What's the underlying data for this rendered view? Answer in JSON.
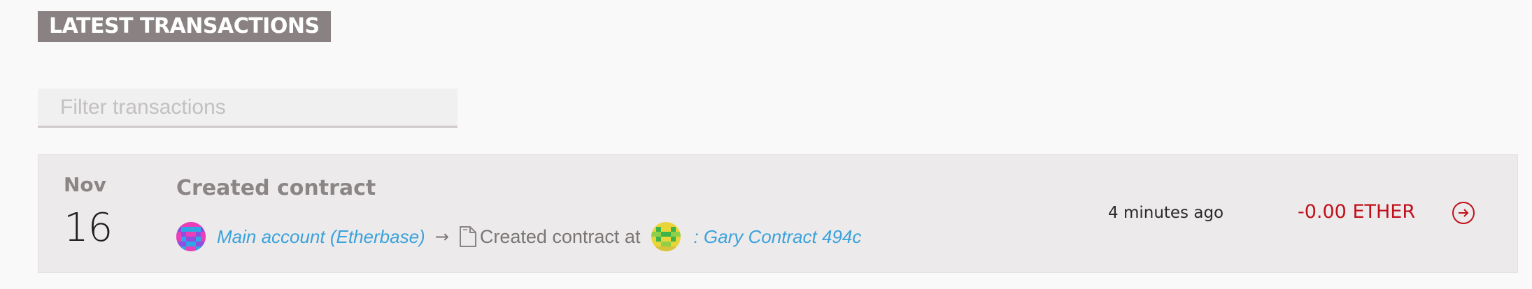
{
  "section": {
    "title": "LATEST TRANSACTIONS"
  },
  "filter": {
    "placeholder": "Filter transactions",
    "value": ""
  },
  "transactions": [
    {
      "month": "Nov",
      "day": "16",
      "title": "Created contract",
      "from": {
        "name": "Main account (Etherbase)",
        "identicon": "pink-purple-identicon"
      },
      "arrow": "→",
      "action_icon": "document-icon",
      "action_text": "Created contract at",
      "to": {
        "name": ": Gary Contract 494c",
        "identicon": "yellow-green-identicon"
      },
      "time_ago": "4 minutes ago",
      "amount": "-0.00 ETHER",
      "open_icon": "arrow-circle-right-icon"
    }
  ],
  "colors": {
    "title_bg": "#8a8282",
    "link": "#3aa2dc",
    "amount_negative": "#c0101c",
    "row_bg": "#eceaea"
  }
}
